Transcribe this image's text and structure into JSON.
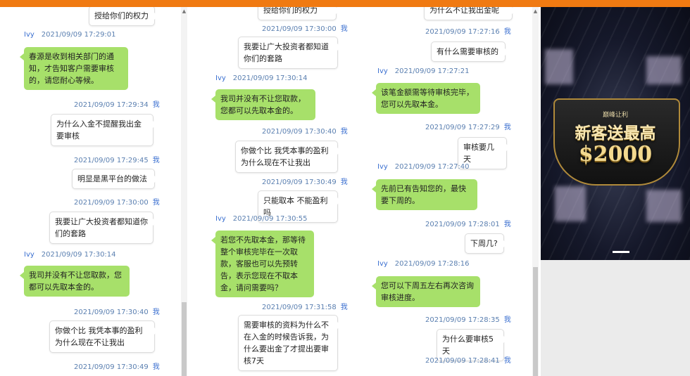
{
  "col1": {
    "messages": [
      {
        "type": "out",
        "text": "授给你们的权力"
      },
      {
        "type": "meta",
        "name": "Ivy",
        "time": "2021/09/09 17:29:01"
      },
      {
        "type": "in",
        "text": "春源是收到相关部门的通知，才告知客户需要审核的，请您耐心等候。"
      },
      {
        "type": "meta",
        "time": "2021/09/09 17:29:34",
        "me": "我"
      },
      {
        "type": "out",
        "text": "为什么入金不提醒我出金要审核"
      },
      {
        "type": "meta",
        "time": "2021/09/09 17:29:45",
        "me": "我"
      },
      {
        "type": "out",
        "text": "明显是黑平台的做法"
      },
      {
        "type": "meta",
        "time": "2021/09/09 17:30:00",
        "me": "我"
      },
      {
        "type": "out",
        "text": "我要让广大投资者都知道你们的套路"
      },
      {
        "type": "meta",
        "name": "Ivy",
        "time": "2021/09/09 17:30:14"
      },
      {
        "type": "in",
        "text": "我司并没有不让您取款，您都可以先取本金的。"
      },
      {
        "type": "meta",
        "time": "2021/09/09 17:30:40",
        "me": "我"
      },
      {
        "type": "out",
        "text": "你做个比 我凭本事的盈利 为什么现在不让我出"
      },
      {
        "type": "meta",
        "time": "2021/09/09 17:30:49",
        "me": "我"
      }
    ]
  },
  "col2": {
    "messages": [
      {
        "type": "out",
        "text": "授给你们的权力"
      },
      {
        "type": "meta",
        "time": "2021/09/09 17:30:00",
        "me": "我"
      },
      {
        "type": "out",
        "text": "我要让广大投资者都知道你们的套路"
      },
      {
        "type": "meta",
        "name": "Ivy",
        "time": "2021/09/09 17:30:14"
      },
      {
        "type": "in",
        "text": "我司并没有不让您取款，您都可以先取本金的。"
      },
      {
        "type": "meta",
        "time": "2021/09/09 17:30:40",
        "me": "我"
      },
      {
        "type": "out",
        "text": "你做个比 我凭本事的盈利 为什么现在不让我出"
      },
      {
        "type": "meta",
        "time": "2021/09/09 17:30:49",
        "me": "我"
      },
      {
        "type": "out",
        "text": "只能取本 不能盈利吗"
      },
      {
        "type": "meta",
        "name": "Ivy",
        "time": "2021/09/09 17:30:55"
      },
      {
        "type": "in",
        "text": "若您不先取本金，那等待整个审核完毕在一次取款，客服也可以先预转告，表示您现在不取本金，请问需要吗？"
      },
      {
        "type": "meta",
        "time": "2021/09/09 17:31:58",
        "me": "我"
      },
      {
        "type": "out",
        "text": "需要审核的资料为什么不在入金的时候告诉我，为什么要出金了才提出要审核7天"
      }
    ]
  },
  "col3": {
    "messages": [
      {
        "type": "out",
        "text": "为什么不让我出金呢"
      },
      {
        "type": "meta",
        "time": "2021/09/09 17:27:16",
        "me": "我"
      },
      {
        "type": "out",
        "text": "有什么需要审核的"
      },
      {
        "type": "meta",
        "name": "Ivy",
        "time": "2021/09/09 17:27:21"
      },
      {
        "type": "in",
        "text": "该笔金额需等待审核完毕，您可以先取本金。"
      },
      {
        "type": "meta",
        "time": "2021/09/09 17:27:29",
        "me": "我"
      },
      {
        "type": "out",
        "text": "审核要几天"
      },
      {
        "type": "meta",
        "name": "Ivy",
        "time": "2021/09/09 17:27:40"
      },
      {
        "type": "in",
        "text": "先前已有告知您的，最快要下周的。"
      },
      {
        "type": "meta",
        "time": "2021/09/09 17:28:01",
        "me": "我"
      },
      {
        "type": "out",
        "text": "下周几?"
      },
      {
        "type": "meta",
        "name": "Ivy",
        "time": "2021/09/09 17:28:16"
      },
      {
        "type": "in",
        "text": "您可以下周五左右再次咨询审核进度。"
      },
      {
        "type": "meta",
        "time": "2021/09/09 17:28:35",
        "me": "我"
      },
      {
        "type": "out",
        "text": "为什么要审核5天"
      },
      {
        "type": "meta",
        "time": "2021/09/09 17:28:41",
        "me": "我"
      }
    ]
  },
  "ad": {
    "small": "巅峰让利",
    "title": "新客送最高",
    "amount": "$2000"
  },
  "colors": {
    "topbar": "#f07a12",
    "incoming": "#a7e06a",
    "outgoing": "#ffffff",
    "meta": "#5a7fb0"
  }
}
